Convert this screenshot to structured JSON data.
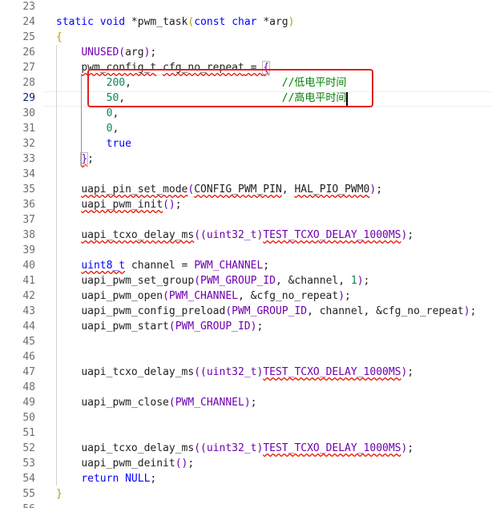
{
  "editor": {
    "lines": [
      {
        "n": "23",
        "tokens": []
      },
      {
        "n": "24",
        "tokens": [
          {
            "t": "static",
            "c": "kw"
          },
          {
            "t": " "
          },
          {
            "t": "void",
            "c": "kw"
          },
          {
            "t": " *pwm_task"
          },
          {
            "t": "(",
            "c": "brace"
          },
          {
            "t": "const",
            "c": "kw"
          },
          {
            "t": " "
          },
          {
            "t": "char",
            "c": "kw"
          },
          {
            "t": " *arg"
          },
          {
            "t": ")",
            "c": "brace"
          }
        ]
      },
      {
        "n": "25",
        "tokens": [
          {
            "t": "{",
            "c": "brace"
          }
        ]
      },
      {
        "n": "26",
        "tokens": [
          {
            "t": "    "
          },
          {
            "t": "UNUSED",
            "c": "macro"
          },
          {
            "t": "(",
            "c": "paren"
          },
          {
            "t": "arg"
          },
          {
            "t": ")",
            "c": "paren"
          },
          {
            "t": ";"
          }
        ]
      },
      {
        "n": "27",
        "tokens": [
          {
            "t": "    "
          },
          {
            "t": "pwm_config_t",
            "s": true
          },
          {
            "t": " "
          },
          {
            "t": "cfg_no_repeat",
            "s": true
          },
          {
            "t": " = ",
            "s": true
          },
          {
            "t": "{",
            "c": "paren",
            "s": true,
            "sel": true
          }
        ]
      },
      {
        "n": "28",
        "tokens": [
          {
            "t": "        "
          },
          {
            "t": "200",
            "c": "num"
          },
          {
            "t": ",                        "
          },
          {
            "t": "//低电平时间",
            "c": "cmt"
          }
        ]
      },
      {
        "n": "29",
        "tokens": [
          {
            "t": "        "
          },
          {
            "t": "50",
            "c": "num"
          },
          {
            "t": ",                         "
          },
          {
            "t": "//高电平时间",
            "c": "cmt"
          }
        ],
        "current": true
      },
      {
        "n": "30",
        "tokens": [
          {
            "t": "        "
          },
          {
            "t": "0",
            "c": "num"
          },
          {
            "t": ","
          }
        ]
      },
      {
        "n": "31",
        "tokens": [
          {
            "t": "        "
          },
          {
            "t": "0",
            "c": "num"
          },
          {
            "t": ","
          }
        ]
      },
      {
        "n": "32",
        "tokens": [
          {
            "t": "        "
          },
          {
            "t": "true",
            "c": "kw"
          }
        ]
      },
      {
        "n": "33",
        "tokens": [
          {
            "t": "    "
          },
          {
            "t": "}",
            "c": "paren",
            "s": true,
            "sel": true
          },
          {
            "t": ";"
          }
        ]
      },
      {
        "n": "34",
        "tokens": []
      },
      {
        "n": "35",
        "tokens": [
          {
            "t": "    "
          },
          {
            "t": "uapi_pin_set_mode",
            "s": true
          },
          {
            "t": "(",
            "c": "paren"
          },
          {
            "t": "CONFIG_PWM_PIN",
            "s": true
          },
          {
            "t": ", "
          },
          {
            "t": "HAL_PIO_PWM0",
            "s": true
          },
          {
            "t": ")",
            "c": "paren"
          },
          {
            "t": ";"
          }
        ]
      },
      {
        "n": "36",
        "tokens": [
          {
            "t": "    "
          },
          {
            "t": "uapi_pwm_init",
            "s": true
          },
          {
            "t": "(",
            "c": "paren"
          },
          {
            "t": ")",
            "c": "paren"
          },
          {
            "t": ";"
          }
        ]
      },
      {
        "n": "37",
        "tokens": []
      },
      {
        "n": "38",
        "tokens": [
          {
            "t": "    "
          },
          {
            "t": "uapi_tcxo_delay_ms",
            "s": true
          },
          {
            "t": "(",
            "c": "paren"
          },
          {
            "t": "(",
            "c": "paren"
          },
          {
            "t": "uint32_t",
            "c": "macro"
          },
          {
            "t": ")",
            "c": "paren"
          },
          {
            "t": "TEST_TCXO_DELAY_1000MS",
            "c": "macro",
            "s": true
          },
          {
            "t": ")",
            "c": "paren"
          },
          {
            "t": ";"
          }
        ]
      },
      {
        "n": "39",
        "tokens": []
      },
      {
        "n": "40",
        "tokens": [
          {
            "t": "    "
          },
          {
            "t": "uint8_t",
            "c": "kw",
            "s": true
          },
          {
            "t": " channel = "
          },
          {
            "t": "PWM_CHANNEL",
            "c": "macro"
          },
          {
            "t": ";"
          }
        ]
      },
      {
        "n": "41",
        "tokens": [
          {
            "t": "    "
          },
          {
            "t": "uapi_pwm_set_group"
          },
          {
            "t": "(",
            "c": "paren"
          },
          {
            "t": "PWM_GROUP_ID",
            "c": "macro"
          },
          {
            "t": ", &channel, "
          },
          {
            "t": "1",
            "c": "num"
          },
          {
            "t": ")",
            "c": "paren"
          },
          {
            "t": ";"
          }
        ]
      },
      {
        "n": "42",
        "tokens": [
          {
            "t": "    "
          },
          {
            "t": "uapi_pwm_open"
          },
          {
            "t": "(",
            "c": "paren"
          },
          {
            "t": "PWM_CHANNEL",
            "c": "macro"
          },
          {
            "t": ", &cfg_no_repeat"
          },
          {
            "t": ")",
            "c": "paren"
          },
          {
            "t": ";"
          }
        ]
      },
      {
        "n": "43",
        "tokens": [
          {
            "t": "    "
          },
          {
            "t": "uapi_pwm_config_preload"
          },
          {
            "t": "(",
            "c": "paren"
          },
          {
            "t": "PWM_GROUP_ID",
            "c": "macro"
          },
          {
            "t": ", channel, &cfg_no_repeat"
          },
          {
            "t": ")",
            "c": "paren"
          },
          {
            "t": ";"
          }
        ]
      },
      {
        "n": "44",
        "tokens": [
          {
            "t": "    "
          },
          {
            "t": "uapi_pwm_start"
          },
          {
            "t": "(",
            "c": "paren"
          },
          {
            "t": "PWM_GROUP_ID",
            "c": "macro"
          },
          {
            "t": ")",
            "c": "paren"
          },
          {
            "t": ";"
          }
        ]
      },
      {
        "n": "45",
        "tokens": []
      },
      {
        "n": "46",
        "tokens": []
      },
      {
        "n": "47",
        "tokens": [
          {
            "t": "    "
          },
          {
            "t": "uapi_tcxo_delay_ms"
          },
          {
            "t": "(",
            "c": "paren"
          },
          {
            "t": "(",
            "c": "paren"
          },
          {
            "t": "uint32_t",
            "c": "macro"
          },
          {
            "t": ")",
            "c": "paren"
          },
          {
            "t": "TEST_TCXO_DELAY_1000MS",
            "c": "macro",
            "s": true
          },
          {
            "t": ")",
            "c": "paren"
          },
          {
            "t": ";"
          }
        ]
      },
      {
        "n": "48",
        "tokens": []
      },
      {
        "n": "49",
        "tokens": [
          {
            "t": "    "
          },
          {
            "t": "uapi_pwm_close"
          },
          {
            "t": "(",
            "c": "paren"
          },
          {
            "t": "PWM_CHANNEL",
            "c": "macro"
          },
          {
            "t": ")",
            "c": "paren"
          },
          {
            "t": ";"
          }
        ]
      },
      {
        "n": "50",
        "tokens": []
      },
      {
        "n": "51",
        "tokens": []
      },
      {
        "n": "52",
        "tokens": [
          {
            "t": "    "
          },
          {
            "t": "uapi_tcxo_delay_ms"
          },
          {
            "t": "(",
            "c": "paren"
          },
          {
            "t": "(",
            "c": "paren"
          },
          {
            "t": "uint32_t",
            "c": "macro"
          },
          {
            "t": ")",
            "c": "paren"
          },
          {
            "t": "TEST_TCXO_DELAY_1000MS",
            "c": "macro",
            "s": true
          },
          {
            "t": ")",
            "c": "paren"
          },
          {
            "t": ";"
          }
        ]
      },
      {
        "n": "53",
        "tokens": [
          {
            "t": "    "
          },
          {
            "t": "uapi_pwm_deinit"
          },
          {
            "t": "(",
            "c": "paren"
          },
          {
            "t": ")",
            "c": "paren"
          },
          {
            "t": ";"
          }
        ]
      },
      {
        "n": "54",
        "tokens": [
          {
            "t": "    "
          },
          {
            "t": "return",
            "c": "kw"
          },
          {
            "t": " "
          },
          {
            "t": "NULL",
            "c": "kw"
          },
          {
            "t": ";"
          }
        ]
      },
      {
        "n": "55",
        "tokens": [
          {
            "t": "}",
            "c": "brace"
          }
        ]
      },
      {
        "n": "56",
        "tokens": []
      }
    ]
  },
  "colors": {
    "highlight_box": "#e02020",
    "keyword": "#0000ff",
    "macro": "#6f00b0",
    "number": "#098658",
    "comment": "#008000",
    "brace": "#b5a000",
    "squiggle": "#e51400"
  }
}
